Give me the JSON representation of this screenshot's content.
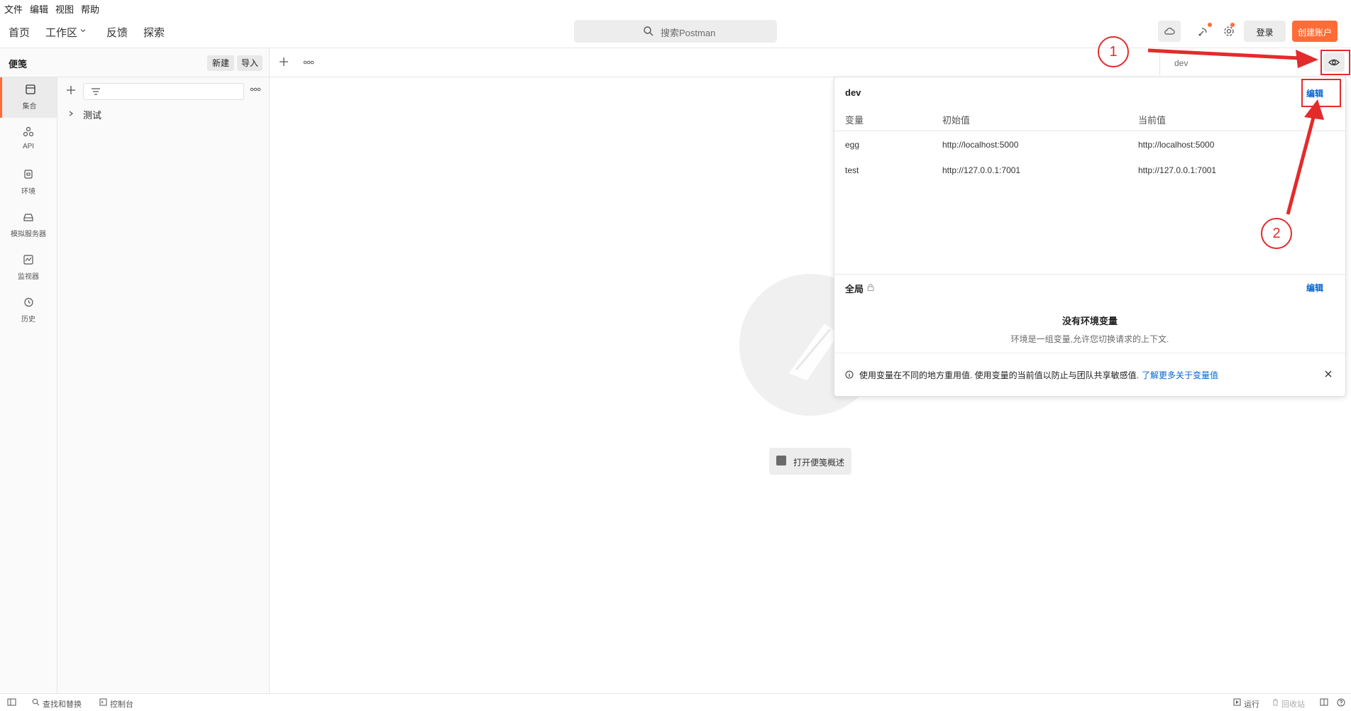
{
  "menu": [
    "文件",
    "编辑",
    "视图",
    "帮助"
  ],
  "header": {
    "nav": {
      "home": "首页",
      "workspace": "工作区",
      "feedback": "反馈",
      "explore": "探索"
    },
    "search_placeholder": "搜索Postman",
    "login_label": "登录",
    "create_account_label": "创建账户",
    "accent_color": "#ff6c37"
  },
  "sidebar": {
    "title": "便笺",
    "new_label": "新建",
    "import_label": "导入",
    "rail": [
      {
        "label": "集合",
        "icon": "collections-icon",
        "active": true
      },
      {
        "label": "API",
        "icon": "api-icon"
      },
      {
        "label": "环境",
        "icon": "environment-icon"
      },
      {
        "label": "模拟服务器",
        "icon": "mock-server-icon"
      },
      {
        "label": "监视器",
        "icon": "monitor-icon"
      },
      {
        "label": "历史",
        "icon": "history-icon"
      }
    ],
    "collections": [
      {
        "name": "测试"
      }
    ]
  },
  "main": {
    "env_selected": "dev",
    "open_overview_label": "打开便笺概述"
  },
  "env_popover": {
    "env_name": "dev",
    "edit_label": "编辑",
    "columns": [
      "变量",
      "初始值",
      "当前值"
    ],
    "rows": [
      {
        "variable": "egg",
        "initial": "http://localhost:5000",
        "current": "http://localhost:5000"
      },
      {
        "variable": "test",
        "initial": "http://127.0.0.1:7001",
        "current": "http://127.0.0.1:7001"
      }
    ],
    "globals_title": "全局",
    "globals_edit_label": "编辑",
    "no_vars_title": "没有环境变量",
    "no_vars_desc": "环境是一组变量,允许您切换请求的上下文.",
    "info_text": "使用变量在不同的地方重用值. 使用变量的当前值以防止与团队共享敏感值.",
    "info_link": "了解更多关于变量值"
  },
  "annotations": {
    "marker1": "1",
    "marker2": "2",
    "color": "#e32b2b"
  },
  "statusbar": {
    "find_replace": "查找和替换",
    "console": "控制台",
    "run": "运行",
    "trash": "回收站"
  }
}
